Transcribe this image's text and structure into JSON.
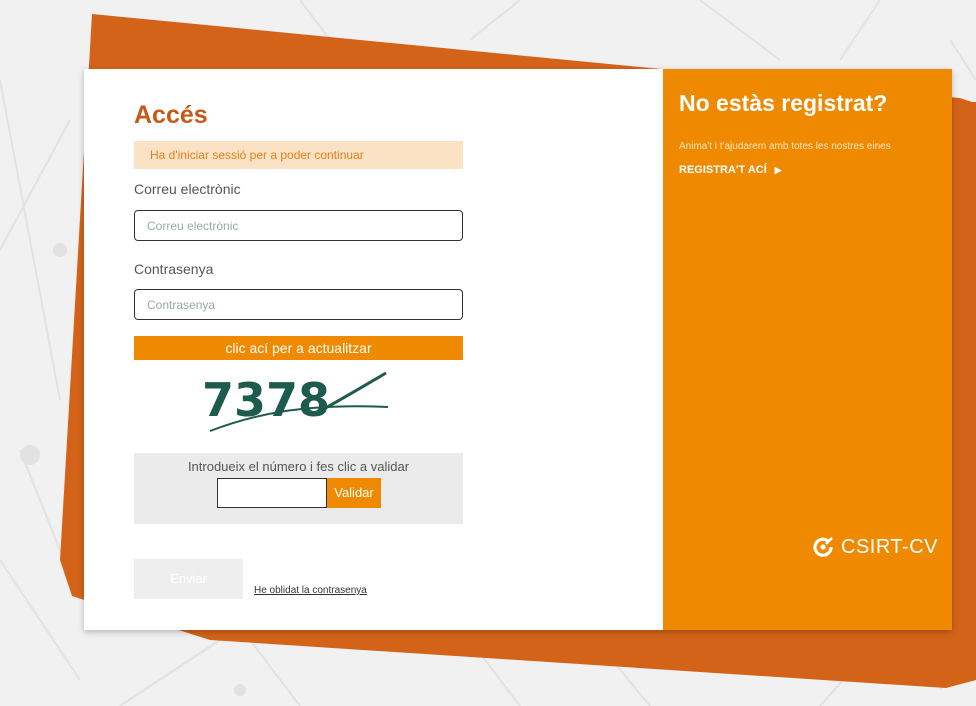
{
  "login": {
    "title": "Accés",
    "alert": "Ha d'iniciar sessió per a poder continuar",
    "email_label": "Correu electrònic",
    "email_placeholder": "Correu electrònic",
    "email_value": "",
    "password_label": "Contrasenya",
    "password_placeholder": "Contrasenya",
    "password_value": "",
    "refresh_label": "clic ací per a actualitzar",
    "captcha_text": "7378",
    "captcha_prompt": "Introdueix el número i fes clic a validar",
    "captcha_value": "",
    "validate_label": "Validar",
    "send_label": "Enviar",
    "forgot_label": "He oblidat la contrasenya"
  },
  "register": {
    "title": "No estàs registrat?",
    "subtitle": "Anima't i t'ajudarem amb totes les nostres eines",
    "link_label": "REGISTRA'T ACÍ",
    "logo_text": "CSIRT-CV"
  },
  "colors": {
    "accent": "#ef8a00",
    "accent_dark": "#d4631a",
    "title": "#c45a17",
    "alert_bg": "#fbe2c4",
    "captcha": "#1d5b4f"
  }
}
